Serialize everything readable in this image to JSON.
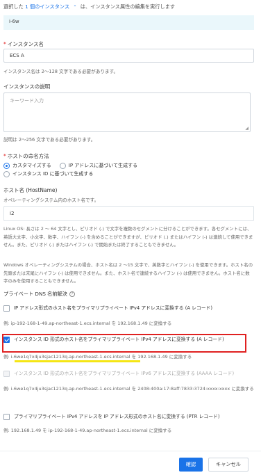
{
  "header": {
    "prefix": "選択した",
    "selection_link": "1 個のインスタンス",
    "caret": "⌃",
    "suffix": "は、インスタンス属性の編集を実行します"
  },
  "instance_id": "i-6w",
  "instance_name": {
    "label": "インスタンス名",
    "value": "ECS A",
    "hint": "インスタンス名は 2～128 文字である必要があります。"
  },
  "description": {
    "label": "インスタンスの説明",
    "placeholder": "キーワード入力",
    "hint": "説明は 2～256 文字である必要があります。"
  },
  "naming": {
    "label": "ホストの命名方法",
    "options": [
      "カスタマイズする",
      "IP アドレスに基づいて生成する",
      "インスタンス ID に基づいて生成する"
    ]
  },
  "hostname": {
    "label": "ホスト名 (HostName)",
    "hint": "オペレーティングシステム内のホスト名です。",
    "value": "i2",
    "linux_rule": "Linux OS: 長さは 2 ～ 64 文字とし、ピリオド (.) で文字を複数のセグメントに分けることができます。各セグメントには、英語大文字、小文字、数字、ハイフン (-) を含めることができますが、ピリオド (.) またはハイフン (-) は連続して使用できません。また、ピリオド (.) またはハイフン (-) で開始または終了することもできません。",
    "windows_rule": "Windows オペレーティングシステムの場合、ホスト名は 2 ～15 文字で、英数字とハイフン (-) を使用できます。ホスト名の先頭または末尾にハイフン (-) は使用できません。また、ホスト名で連続するハイフン (-) は使用できません。ホスト名に数字のみを使用することもできません。"
  },
  "dns": {
    "title": "プライベート DNS 名前解決",
    "help": "?",
    "options": [
      {
        "label": "IP アドレス形式のホスト名をプライマリプライベート IPv4 アドレスに変換する (A レコード)",
        "example": "例:  ip-192-168-1-49.ap-northeast-1.ecs.internal を 192.168.1.49 に変換する"
      },
      {
        "label": "インスタンス ID 形式のホスト名をプライマリプライベート IPv4 アドレスに変換する (A レコード)",
        "example": "例:  i-6we1q7x4ju3sjac1213q.ap-northeast-1.ecs.internal を 192.168.1.49 に変換する"
      },
      {
        "label": "インスタンス ID 形式のホスト名をプライマリプライベート IPv6 アドレスに変換する (AAAA レコード)",
        "example": "例:  i-6we1q7x4ju3sjac1213q.ap-northeast-1.ecs.internal を 2408:400a:17:8aff:7833:3724:xxxx:xxxx に変換する"
      },
      {
        "label": "プライマリプライベート IPv4 アドレスを IP アドレス形式のホスト名に変換する (PTR レコード)",
        "example": "例:  192.168.1.49 を ip-192-168-1-49.ap-northeast-1.ecs.internal に変換する"
      }
    ]
  },
  "footer": {
    "confirm": "確認",
    "cancel": "キャンセル"
  },
  "colors": {
    "primary": "#1a73e8",
    "annotation_red": "#e02020",
    "annotation_yellow": "#f5e614",
    "id_box_bg": "#eaf7fb"
  }
}
